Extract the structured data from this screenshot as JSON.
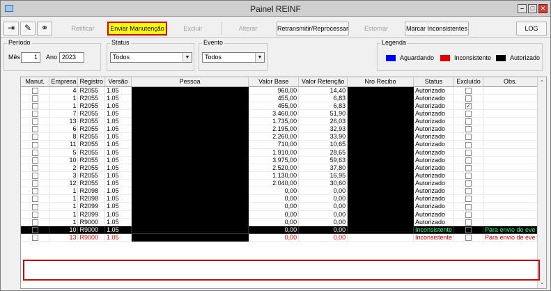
{
  "window": {
    "title": "Painel REINF"
  },
  "toolbar": {
    "retificar": "Retificar",
    "enviar": "Enviar Manutenção",
    "excluir": "Excluir",
    "alterar": "Alterar",
    "retransmitir": "Retransmitir/Reprocessar",
    "estornar": "Estornar",
    "marcar": "Marcar Inconsistentes",
    "log": "LOG"
  },
  "filters": {
    "periodo_label": "Período",
    "mes_label": "Mês",
    "mes_value": "1",
    "ano_label": "Ano",
    "ano_value": "2023",
    "status_label": "Status",
    "status_value": "Todos",
    "evento_label": "Evento",
    "evento_value": "Todos"
  },
  "legend": {
    "title": "Legenda",
    "items": [
      {
        "label": "Aguardando",
        "color": "#0000ff"
      },
      {
        "label": "Inconsistente",
        "color": "#e00000"
      },
      {
        "label": "Autorizado",
        "color": "#000000"
      }
    ]
  },
  "grid": {
    "columns": [
      "Manut.",
      "Empresa",
      "Registro",
      "Versão",
      "Pessoa",
      "Valor Base",
      "Valor Retenção",
      "Nro Recibo",
      "Status",
      "Excluído",
      "Obs."
    ],
    "rows": [
      {
        "empresa": "4",
        "registro": "R2055",
        "versao": "1.05",
        "base": "960,00",
        "retencao": "14,40",
        "status": "Autorizado",
        "excluido": false,
        "obs": ""
      },
      {
        "empresa": "1",
        "registro": "R2055",
        "versao": "1.05",
        "base": "455,00",
        "retencao": "6,83",
        "status": "Autorizado",
        "excluido": false,
        "obs": ""
      },
      {
        "empresa": "1",
        "registro": "R2055",
        "versao": "1.05",
        "base": "455,00",
        "retencao": "6,83",
        "status": "Autorizado",
        "excluido": true,
        "obs": ""
      },
      {
        "empresa": "7",
        "registro": "R2055",
        "versao": "1.05",
        "base": "3.460,00",
        "retencao": "51,90",
        "status": "Autorizado",
        "excluido": false,
        "obs": ""
      },
      {
        "empresa": "13",
        "registro": "R2055",
        "versao": "1.05",
        "base": "1.735,00",
        "retencao": "26,03",
        "status": "Autorizado",
        "excluido": false,
        "obs": ""
      },
      {
        "empresa": "6",
        "registro": "R2055",
        "versao": "1.05",
        "base": "2.195,00",
        "retencao": "32,93",
        "status": "Autorizado",
        "excluido": false,
        "obs": ""
      },
      {
        "empresa": "8",
        "registro": "R2055",
        "versao": "1.05",
        "base": "2.260,00",
        "retencao": "33,90",
        "status": "Autorizado",
        "excluido": false,
        "obs": ""
      },
      {
        "empresa": "11",
        "registro": "R2055",
        "versao": "1.05",
        "base": "710,00",
        "retencao": "10,65",
        "status": "Autorizado",
        "excluido": false,
        "obs": ""
      },
      {
        "empresa": "5",
        "registro": "R2055",
        "versao": "1.05",
        "base": "1.910,00",
        "retencao": "28,65",
        "status": "Autorizado",
        "excluido": false,
        "obs": ""
      },
      {
        "empresa": "10",
        "registro": "R2055",
        "versao": "1.05",
        "base": "3.975,00",
        "retencao": "59,63",
        "status": "Autorizado",
        "excluido": false,
        "obs": ""
      },
      {
        "empresa": "2",
        "registro": "R2055",
        "versao": "1.05",
        "base": "2.520,00",
        "retencao": "37,80",
        "status": "Autorizado",
        "excluido": false,
        "obs": ""
      },
      {
        "empresa": "3",
        "registro": "R2055",
        "versao": "1.05",
        "base": "1.130,00",
        "retencao": "16,95",
        "status": "Autorizado",
        "excluido": false,
        "obs": ""
      },
      {
        "empresa": "12",
        "registro": "R2055",
        "versao": "1.05",
        "base": "2.040,00",
        "retencao": "30,60",
        "status": "Autorizado",
        "excluido": false,
        "obs": ""
      },
      {
        "empresa": "1",
        "registro": "R2098",
        "versao": "1.05",
        "base": "0,00",
        "retencao": "0,00",
        "status": "Autorizado",
        "excluido": false,
        "obs": ""
      },
      {
        "empresa": "1",
        "registro": "R2098",
        "versao": "1.05",
        "base": "0,00",
        "retencao": "0,00",
        "status": "Autorizado",
        "excluido": false,
        "obs": ""
      },
      {
        "empresa": "1",
        "registro": "R2099",
        "versao": "1.05",
        "base": "0,00",
        "retencao": "0,00",
        "status": "Autorizado",
        "excluido": false,
        "obs": ""
      },
      {
        "empresa": "1",
        "registro": "R2099",
        "versao": "1.05",
        "base": "0,00",
        "retencao": "0,00",
        "status": "Autorizado",
        "excluido": false,
        "obs": ""
      },
      {
        "empresa": "1",
        "registro": "R9000",
        "versao": "1.05",
        "base": "0,00",
        "retencao": "0,00",
        "status": "Autorizado",
        "excluido": false,
        "obs": ""
      },
      {
        "empresa": "10",
        "registro": "R9000",
        "versao": "1.05",
        "base": "0,00",
        "retencao": "0,00",
        "status": "Inconsistente",
        "excluido": false,
        "obs": "Para envio de eve",
        "style": "selected"
      },
      {
        "empresa": "13",
        "registro": "R9000",
        "versao": "1.05",
        "base": "0,00",
        "retencao": "0,00",
        "status": "Inconsistente",
        "excluido": false,
        "obs": "Para envio de eve",
        "style": "inconsistent"
      }
    ]
  }
}
